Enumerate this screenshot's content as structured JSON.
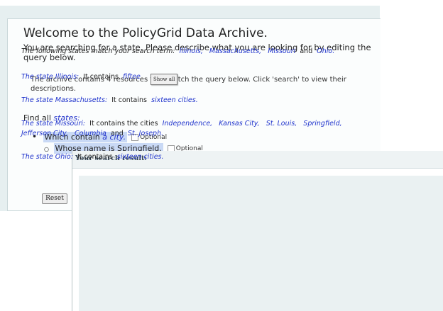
{
  "archive": {
    "title": "Welcome to the PolicyGrid Data Archive.",
    "intro": "You are searching for a state. Please describe what you are looking for by editing the query below.",
    "resources_note": "The archive contains 4 resources that match the query below. Click 'search' to view their descriptions.",
    "query": {
      "find_prefix": "Find all",
      "find_term": "states:",
      "bullet_prefix": "Which contain",
      "bullet_term": "a city.",
      "sub_bullet": "Whose name is Springfield.",
      "optional_label": "Optional"
    },
    "reset_label": "Reset"
  },
  "result": {
    "header": "Your search result:",
    "summary": {
      "prefix": "The following states match your search term:",
      "states": [
        "Illinois,",
        "Massachusetts,",
        "Missouri"
      ],
      "conj": "and",
      "last": "Ohio."
    },
    "illinois": {
      "label": "The state Illinois:",
      "text": "It contains",
      "value": "fiftee"
    },
    "show_all_label": "Show all",
    "massachusetts": {
      "label": "The state Massachusetts:",
      "text": "It contains",
      "value": "sixteen cities."
    },
    "missouri": {
      "label": "The state Missouri:",
      "text": "It contains the cities",
      "cities_line1": [
        "Independence,",
        "Kansas City,",
        "St. Louis,",
        "Springfield,"
      ],
      "cities_line2": [
        "Jefferson City,",
        "Columbia"
      ],
      "conj": "and",
      "last": "St. Joseph."
    },
    "ohio": {
      "label": "The state Ohio:",
      "text": "It contains",
      "value": "sixteen cities."
    }
  }
}
